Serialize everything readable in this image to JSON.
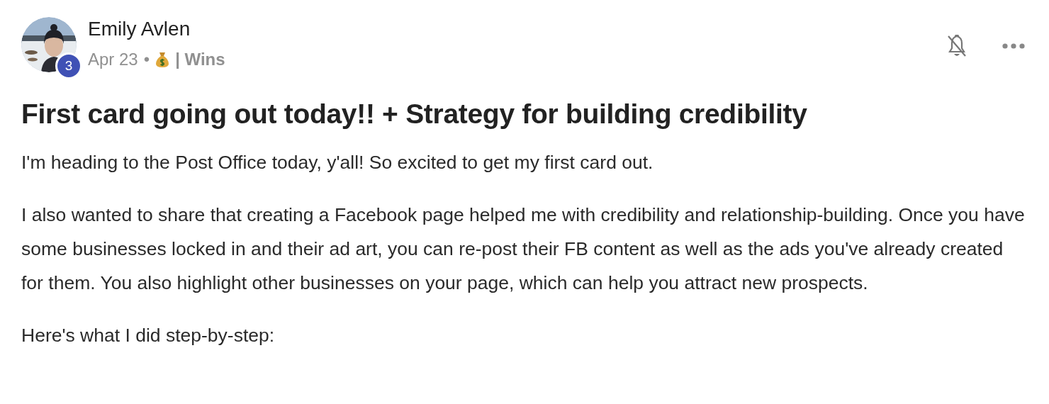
{
  "author": {
    "name": "Emily Avlen",
    "level_badge": "3"
  },
  "meta": {
    "date": "Apr 23",
    "separator": "•",
    "category": "| Wins"
  },
  "actions": {
    "notifications_muted": true
  },
  "title": "First card going out today!! + Strategy for building credibility",
  "paragraphs": [
    "I'm heading to the Post Office today, y'all! So excited to get my first card out.",
    "I also wanted to share that creating a Facebook page helped me with credibility and relationship-building. Once you have some businesses locked in and their ad art, you can re-post their FB content as well as the ads you've already created for them. You also highlight other businesses on your page, which can help you attract new prospects.",
    "Here's what I did step-by-step:"
  ]
}
